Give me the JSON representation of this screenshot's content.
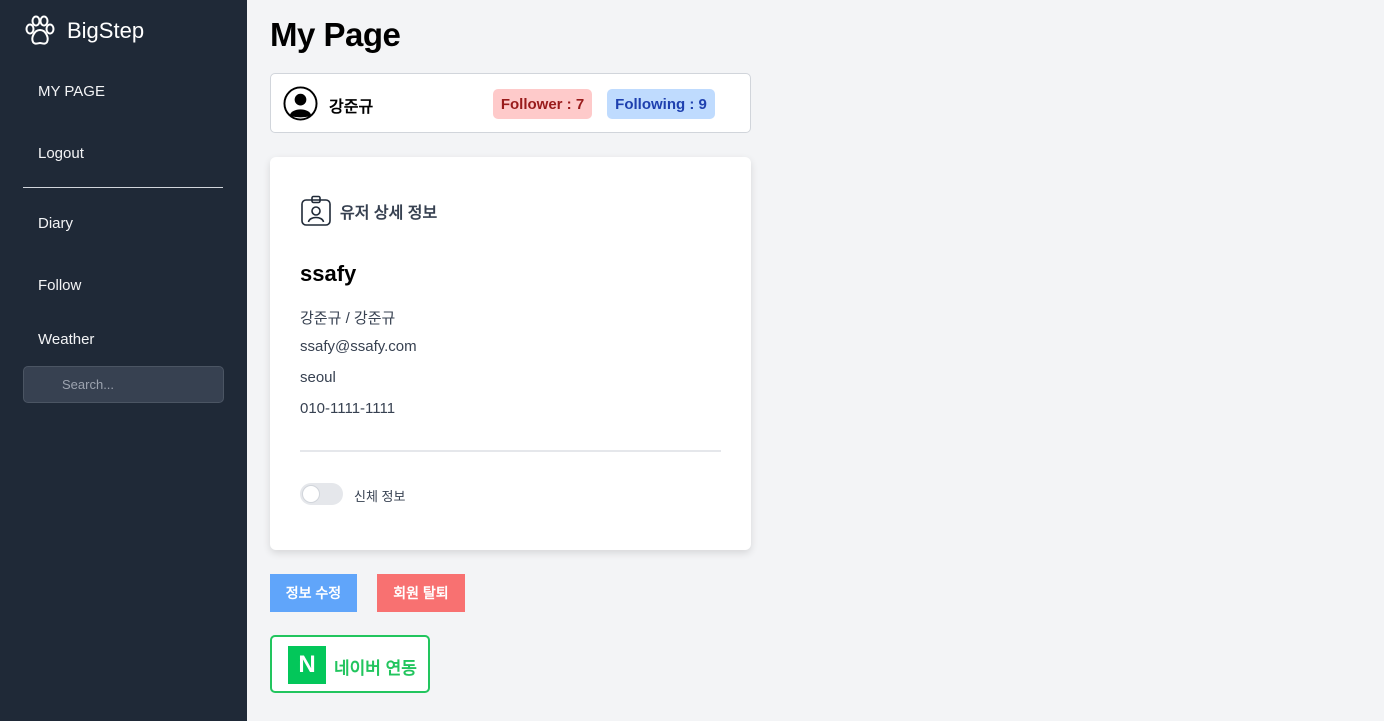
{
  "sidebar": {
    "brand": "BigStep",
    "items": [
      {
        "label": "MY PAGE"
      },
      {
        "label": "Logout"
      },
      {
        "label": "Diary"
      },
      {
        "label": "Follow"
      },
      {
        "label": "Weather"
      }
    ],
    "search_placeholder": "Search..."
  },
  "page": {
    "title": "My Page"
  },
  "profile": {
    "name": "강준규",
    "follower": "Follower : 7",
    "following": "Following : 9"
  },
  "details": {
    "header": "유저 상세 정보",
    "username": "ssafy",
    "names": "강준규 / 강준규",
    "email": "ssafy@ssafy.com",
    "city": "seoul",
    "phone": "010-1111-1111",
    "toggle_label": "신체 정보",
    "toggle_on": false
  },
  "actions": {
    "edit": "정보 수정",
    "withdraw": "회원 탈퇴",
    "naver_logo": "N",
    "naver_link": "네이버 연동"
  },
  "colors": {
    "sidebar": "#1f2937",
    "follower_badge": "#fecaca",
    "following_badge": "#bfdbfe",
    "edit_button": "#60a5fa",
    "withdraw_button": "#f87171",
    "naver_green": "#03c75a"
  },
  "icons": {
    "brand": "paw-icon",
    "avatar": "user-avatar-icon",
    "details": "id-badge-icon"
  }
}
